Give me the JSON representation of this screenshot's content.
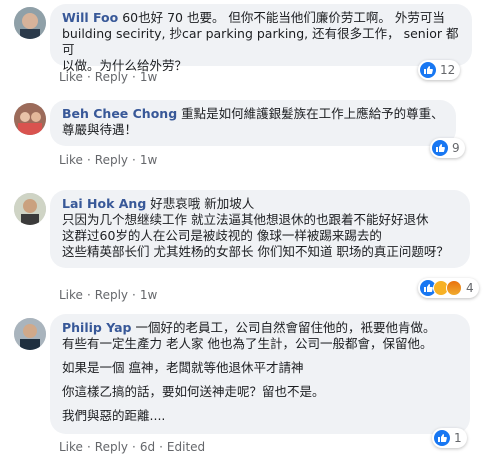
{
  "comments": [
    {
      "author": "Will Foo",
      "lines": [
        "60也好 70 也要。 但你不能当他们廉价劳工啊。 外劳可当",
        "building secirity, 抄car parking parking, 还有很多工作， senior 都可",
        "以做。为什么给外劳？"
      ],
      "actions": {
        "like": "Like",
        "reply": "Reply",
        "time": "1w"
      },
      "reaction_count": "12",
      "reaction_types": [
        "like-icon"
      ]
    },
    {
      "author": "Beh Chee Chong",
      "lines": [
        "重點是如何維護銀髮族在工作上應給予的尊重、",
        "尊嚴與待遇！"
      ],
      "actions": {
        "like": "Like",
        "reply": "Reply",
        "time": "1w"
      },
      "reaction_count": "9",
      "reaction_types": [
        "like-icon"
      ]
    },
    {
      "author": "Lai Hok Ang",
      "lines": [
        "好悲哀哦 新加坡人",
        "只因为几个想继续工作 就立法逼其他想退休的也跟着不能好好退休",
        "这群过60岁的人在公司是被歧视的 像球一样被踢来踢去的",
        "这些精英部长们 尤其姓杨的女部长 你们知不知道 职场的真正问题呀？"
      ],
      "actions": {
        "like": "Like",
        "reply": "Reply",
        "time": "1w"
      },
      "reaction_count": "4",
      "reaction_types": [
        "like-icon",
        "haha-icon",
        "angry-icon"
      ]
    },
    {
      "author": "Philip Yap",
      "paragraphs": [
        [
          "一個好的老員工，公司自然會留住他的，衹要他肯做。",
          "有些有一定生產力 老人家 他也為了生計，公司一般都會，保留他。"
        ],
        [
          "如果是一個 瘟神，老闆就等他退休平才請神"
        ],
        [
          "你這樣乙搞的話，要如何送神走呢？留也不是。"
        ],
        [
          "我們與惡的距離...."
        ]
      ],
      "actions": {
        "like": "Like",
        "reply": "Reply",
        "time": "6d",
        "edited": "Edited"
      },
      "reaction_count": "1",
      "reaction_types": [
        "like-icon"
      ]
    }
  ],
  "colors": {
    "author": "#385898",
    "bubble": "#f0f2f5",
    "like": "#1877f2",
    "meta": "#65676b"
  }
}
